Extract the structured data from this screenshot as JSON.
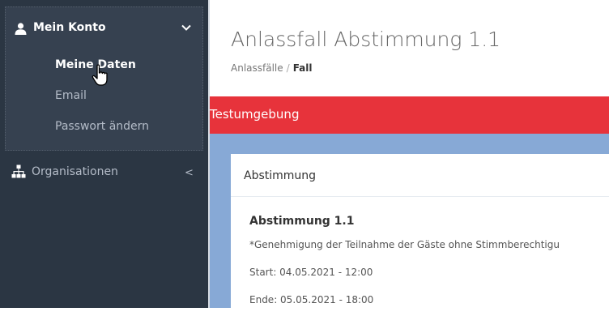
{
  "sidebar": {
    "account": {
      "label": "Mein Konto",
      "icon": "user-icon",
      "subitems": [
        {
          "label": "Meine Daten",
          "active": true
        },
        {
          "label": "Email",
          "active": false
        },
        {
          "label": "Passwort ändern",
          "active": false
        }
      ]
    },
    "organizations": {
      "label": "Organisationen",
      "icon": "sitemap-icon"
    }
  },
  "main": {
    "title": "Anlassfall Abstimmung 1.1",
    "breadcrumb": [
      {
        "label": "Anlassfälle"
      },
      {
        "label": "Fall"
      }
    ],
    "breadcrumb_separator": "/",
    "env_banner": "Testumgebung",
    "portlet": {
      "title": "Abstimmung",
      "vote_title": "Abstimmung 1.1",
      "note": "*Genehmigung der Teilnahme der Gäste ohne Stimmberechtigu",
      "start": "Start: 04.05.2021 - 12:00",
      "end": "Ende: 05.05.2021 - 18:00"
    }
  },
  "colors": {
    "sidebar_bg": "#2b3643",
    "sidebar_section_bg": "#364150",
    "banner_red": "#e7333b",
    "area_blue": "#87a9d6"
  }
}
